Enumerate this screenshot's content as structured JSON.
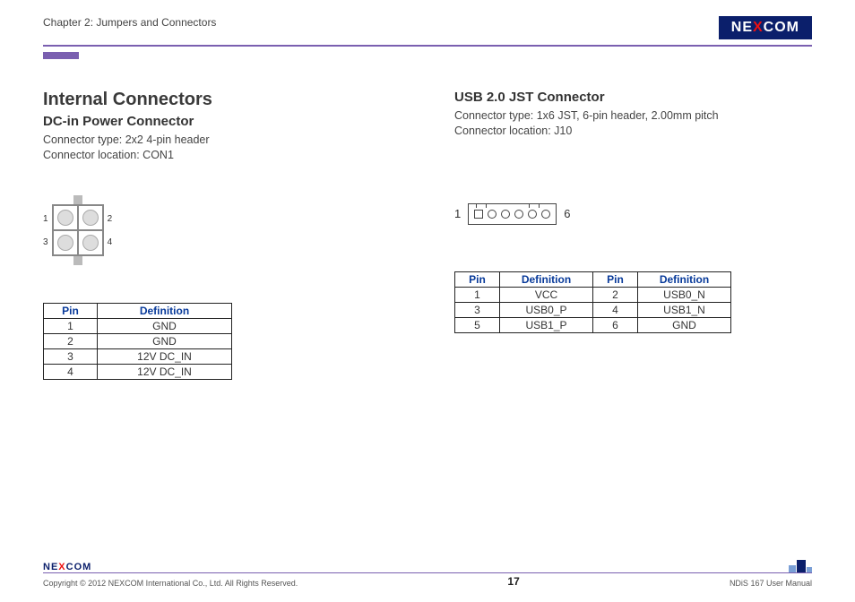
{
  "header": {
    "chapter": "Chapter 2: Jumpers and Connectors",
    "logo_left": "NE",
    "logo_mid": "X",
    "logo_right": "COM"
  },
  "left": {
    "title": "Internal Connectors",
    "subtitle": "DC-in Power Connector",
    "line1": "Connector type: 2x2 4-pin header",
    "line2": "Connector location: CON1",
    "pin1": "1",
    "pin2": "2",
    "pin3": "3",
    "pin4": "4",
    "th_pin": "Pin",
    "th_def": "Definition",
    "rows": [
      {
        "pin": "1",
        "def": "GND"
      },
      {
        "pin": "2",
        "def": "GND"
      },
      {
        "pin": "3",
        "def": "12V DC_IN"
      },
      {
        "pin": "4",
        "def": "12V DC_IN"
      }
    ]
  },
  "right": {
    "subtitle": "USB 2.0 JST Connector",
    "line1": "Connector type: 1x6 JST, 6-pin header, 2.00mm pitch",
    "line2": "Connector location: J10",
    "lbl1": "1",
    "lbl6": "6",
    "th_pin": "Pin",
    "th_def": "Definition",
    "rows": [
      {
        "p1": "1",
        "d1": "VCC",
        "p2": "2",
        "d2": "USB0_N"
      },
      {
        "p1": "3",
        "d1": "USB0_P",
        "p2": "4",
        "d2": "USB1_N"
      },
      {
        "p1": "5",
        "d1": "USB1_P",
        "p2": "6",
        "d2": "GND"
      }
    ]
  },
  "footer": {
    "logo_left": "NE",
    "logo_mid": "X",
    "logo_right": "COM",
    "copyright": "Copyright © 2012 NEXCOM International Co., Ltd. All Rights Reserved.",
    "page": "17",
    "manual": "NDiS 167 User Manual"
  }
}
